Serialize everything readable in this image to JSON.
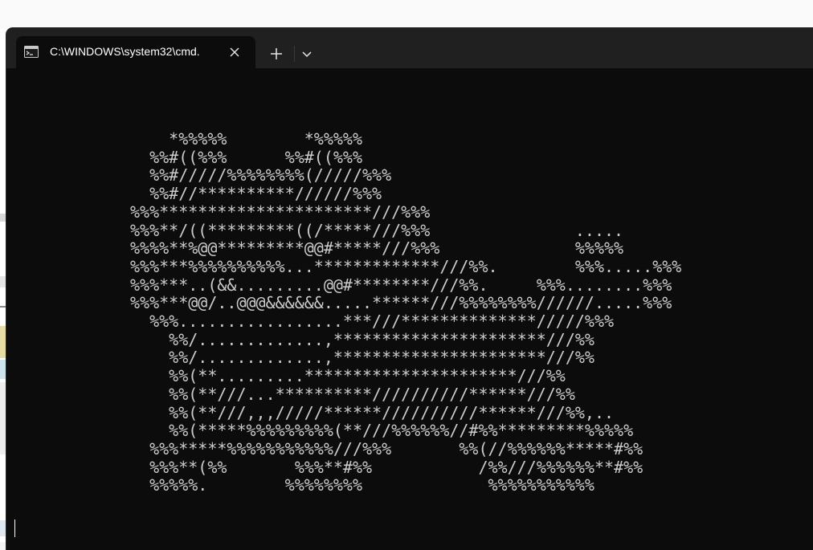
{
  "window": {
    "tab_title": "C:\\WINDOWS\\system32\\cmd.",
    "icons": {
      "tab": "console-icon",
      "close": "close-icon",
      "new_tab": "plus-icon",
      "dropdown": "chevron-down-icon"
    }
  },
  "console": {
    "output": "    *%%%%%        *%%%%%\n  %%#((%%%      %%#((%%%\n  %%#/////%%%%%%%%(/////%%%\n  %%#//**********//////%%%\n%%%**********************///%%%\n%%%**/((*********((/*****///%%%               .....\n%%%%**%@@*********@@#*****///%%%              %%%%%\n%%%***%%%%%%%%%%...*************///%%.        %%%.....%%%\n%%%***..(&&.........@@#********///%%.     %%%........%%%\n%%%***@@/..@@@&&&&&&.....******///%%%%%%%%//////.....%%%\n  %%%.................***///**************/////%%%\n    %%/.............,**********************///%%\n    %%/.............,**********************///%%\n    %%(**.........**********************///%%\n    %%(**///...**********//////////******///%%\n    %%(**///,,,/////******//////////******///%%,..\n    %%(*****%%%%%%%%%(**///%%%%%%//#%%*********%%%%%\n  %%%*****%%%%%%%%%%%///%%%       %%(//%%%%%%*****#%%\n  %%%**(%%       %%%**#%%           /%%///%%%%%%**#%%\n  %%%%%.        %%%%%%%%             %%%%%%%%%%%"
  },
  "colors": {
    "background": "#0c0c0c",
    "tabbar": "#202020",
    "text": "#cccccc"
  }
}
